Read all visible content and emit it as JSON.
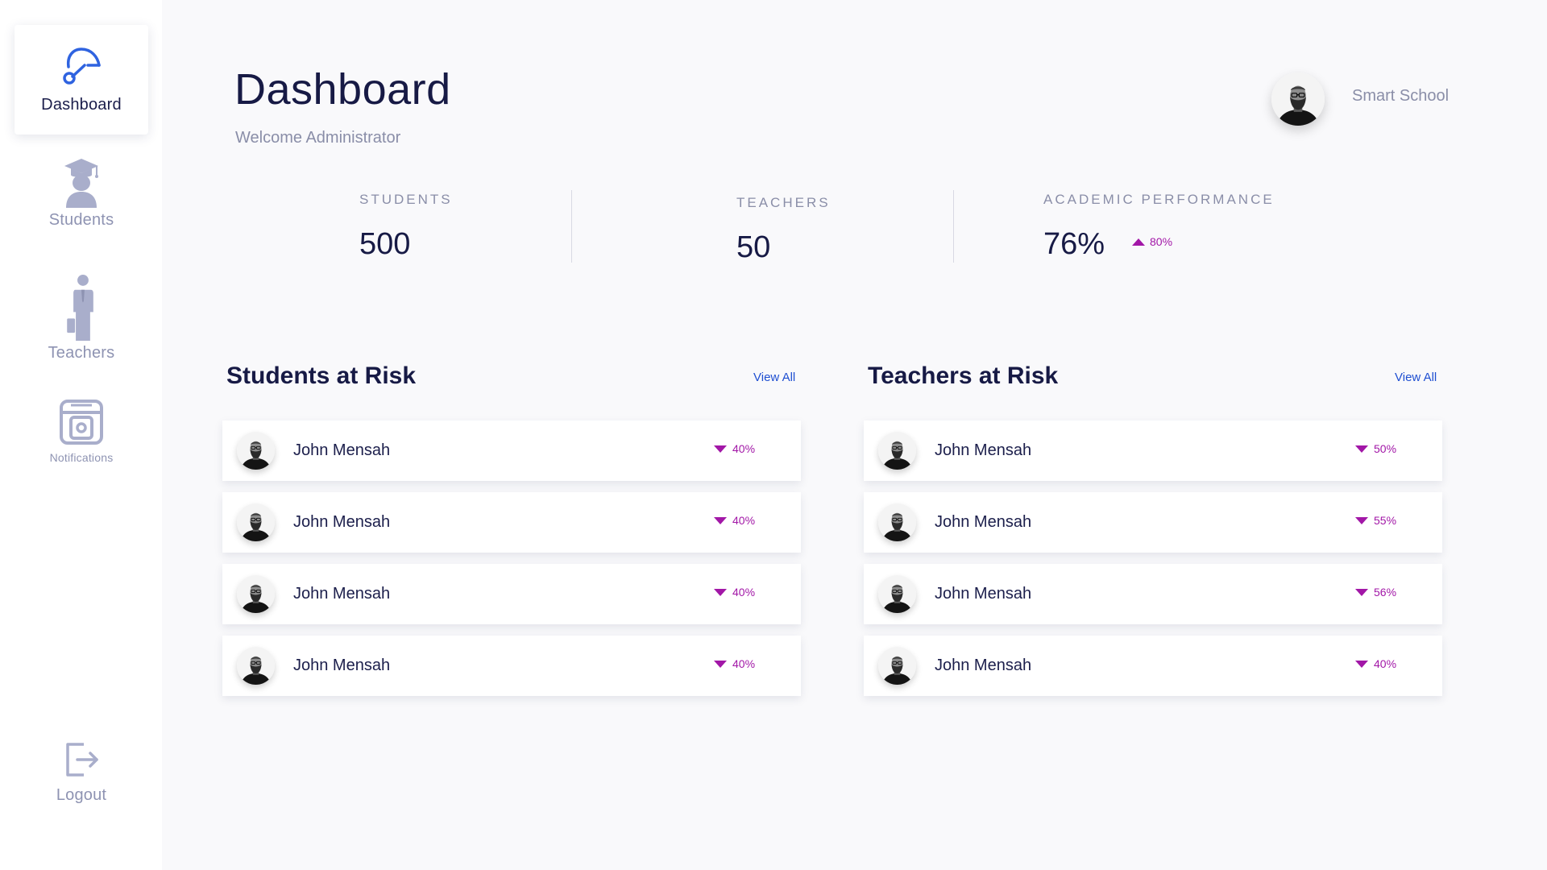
{
  "colors": {
    "accent_blue": "#1f4fd1",
    "trend_purple": "#a217a7",
    "title_navy": "#171a45",
    "muted_text": "#8a8ea8",
    "sidebar_icon": "#a9aecb",
    "background": "#f9f9fb"
  },
  "sidebar": {
    "items": [
      {
        "label": "Dashboard",
        "icon": "dashboard-gauge-icon",
        "active": true
      },
      {
        "label": "Students",
        "icon": "graduate-icon",
        "active": false
      },
      {
        "label": "Teachers",
        "icon": "teacher-icon",
        "active": false
      },
      {
        "label": "Notifications",
        "icon": "notifications-icon",
        "active": false
      }
    ],
    "logout": {
      "label": "Logout",
      "icon": "logout-icon"
    }
  },
  "header": {
    "title": "Dashboard",
    "subtitle": "Welcome Administrator",
    "school_name": "Smart School",
    "avatar_icon": "user-avatar-icon"
  },
  "stats": {
    "students": {
      "label": "STUDENTS",
      "value": "500"
    },
    "teachers": {
      "label": "TEACHERS",
      "value": "50"
    },
    "academic": {
      "label": "ACADEMIC PERFORMANCE",
      "value": "76%",
      "trend": "80%",
      "trend_direction": "up"
    }
  },
  "students_at_risk": {
    "title": "Students at Risk",
    "view_all": "View All",
    "rows": [
      {
        "name": "John Mensah",
        "score": "40%",
        "direction": "down"
      },
      {
        "name": "John Mensah",
        "score": "40%",
        "direction": "down"
      },
      {
        "name": "John Mensah",
        "score": "40%",
        "direction": "down"
      },
      {
        "name": "John Mensah",
        "score": "40%",
        "direction": "down"
      }
    ]
  },
  "teachers_at_risk": {
    "title": "Teachers at Risk",
    "view_all": "View All",
    "rows": [
      {
        "name": "John Mensah",
        "score": "50%",
        "direction": "down"
      },
      {
        "name": "John Mensah",
        "score": "55%",
        "direction": "down"
      },
      {
        "name": "John Mensah",
        "score": "56%",
        "direction": "down"
      },
      {
        "name": "John Mensah",
        "score": "40%",
        "direction": "down"
      }
    ]
  }
}
